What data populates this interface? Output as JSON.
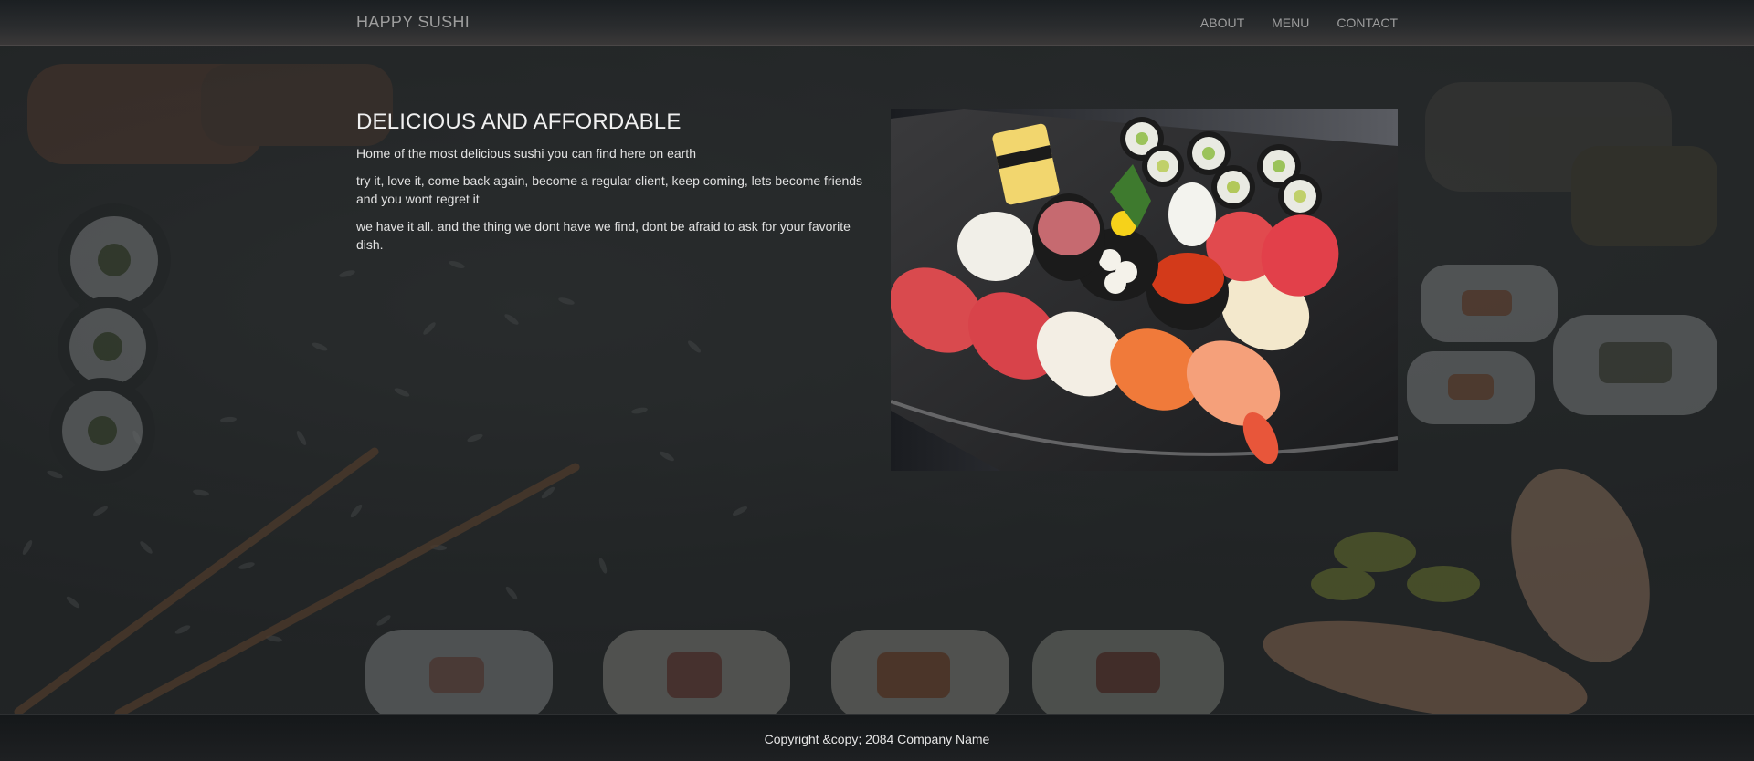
{
  "navbar": {
    "brand": "HAPPY SUSHI",
    "links": [
      {
        "label": "ABOUT"
      },
      {
        "label": "MENU"
      },
      {
        "label": "CONTACT"
      }
    ]
  },
  "main": {
    "headline": "DELICIOUS AND AFFORDABLE",
    "paragraphs": [
      "Home of the most delicious sushi you can find here on earth",
      "try it, love it, come back again, become a regular client, keep coming, lets become friends and you wont regret it",
      "we have it all. and the thing we dont have we find, dont be afraid to ask for your favorite dish."
    ]
  },
  "footer": {
    "copyright": "Copyright &copy; 2084 Company Name"
  },
  "colors": {
    "nav_text": "#9d9d9d",
    "body_text": "#e2e2e2",
    "navbar_bg": "#2a2c2e",
    "footer_bg": "#1e2022"
  }
}
